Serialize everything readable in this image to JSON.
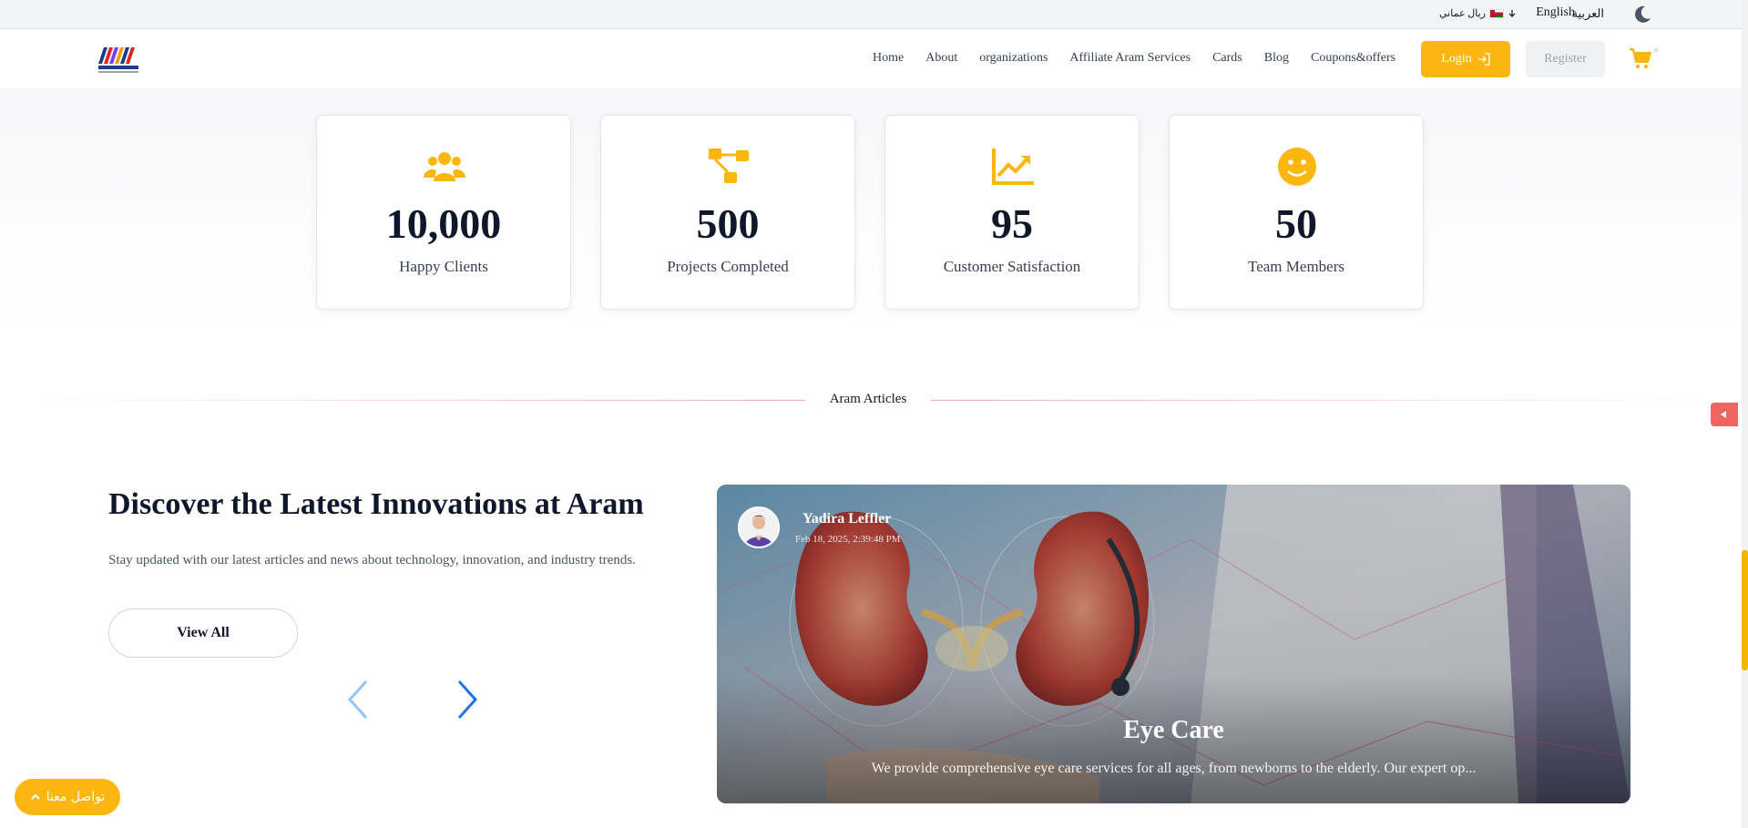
{
  "topbar": {
    "currency_label": "ريال عماني",
    "lang_en": "English",
    "lang_ar": "العربية",
    "theme_icon": "moon-icon"
  },
  "header": {
    "logo": "aram-logo",
    "nav": [
      "Home",
      "About",
      "organizations",
      "Affiliate Aram Services",
      "Cards",
      "Blog",
      "Coupons&offers"
    ],
    "login_label": "Login",
    "register_label": "Register",
    "cart_icon": "cart-icon"
  },
  "stats": [
    {
      "icon": "users-icon",
      "value": "10,000",
      "label": "Happy Clients"
    },
    {
      "icon": "sitemap-icon",
      "value": "500",
      "label": "Projects Completed"
    },
    {
      "icon": "chart-line-icon",
      "value": "95",
      "label": "Customer Satisfaction"
    },
    {
      "icon": "smile-icon",
      "value": "50",
      "label": "Team Members"
    }
  ],
  "section_label": "Aram Articles",
  "articles": {
    "title": "Discover the Latest Innovations at Aram",
    "subtitle": "Stay updated with our latest articles and news about technology, innovation, and industry trends.",
    "view_all_label": "View All"
  },
  "card": {
    "author": "Yadira Leffler",
    "date": "Feb 18, 2025, 2:39:48 PM",
    "title": "Eye Care",
    "description": "We provide comprehensive eye care services for all ages, from newborns to the elderly. Our expert op..."
  },
  "contact_label": "تواصل معنا",
  "colors": {
    "accent": "#fbb70f",
    "side_tab": "#ef6461",
    "arrow": "#1a73e8"
  }
}
